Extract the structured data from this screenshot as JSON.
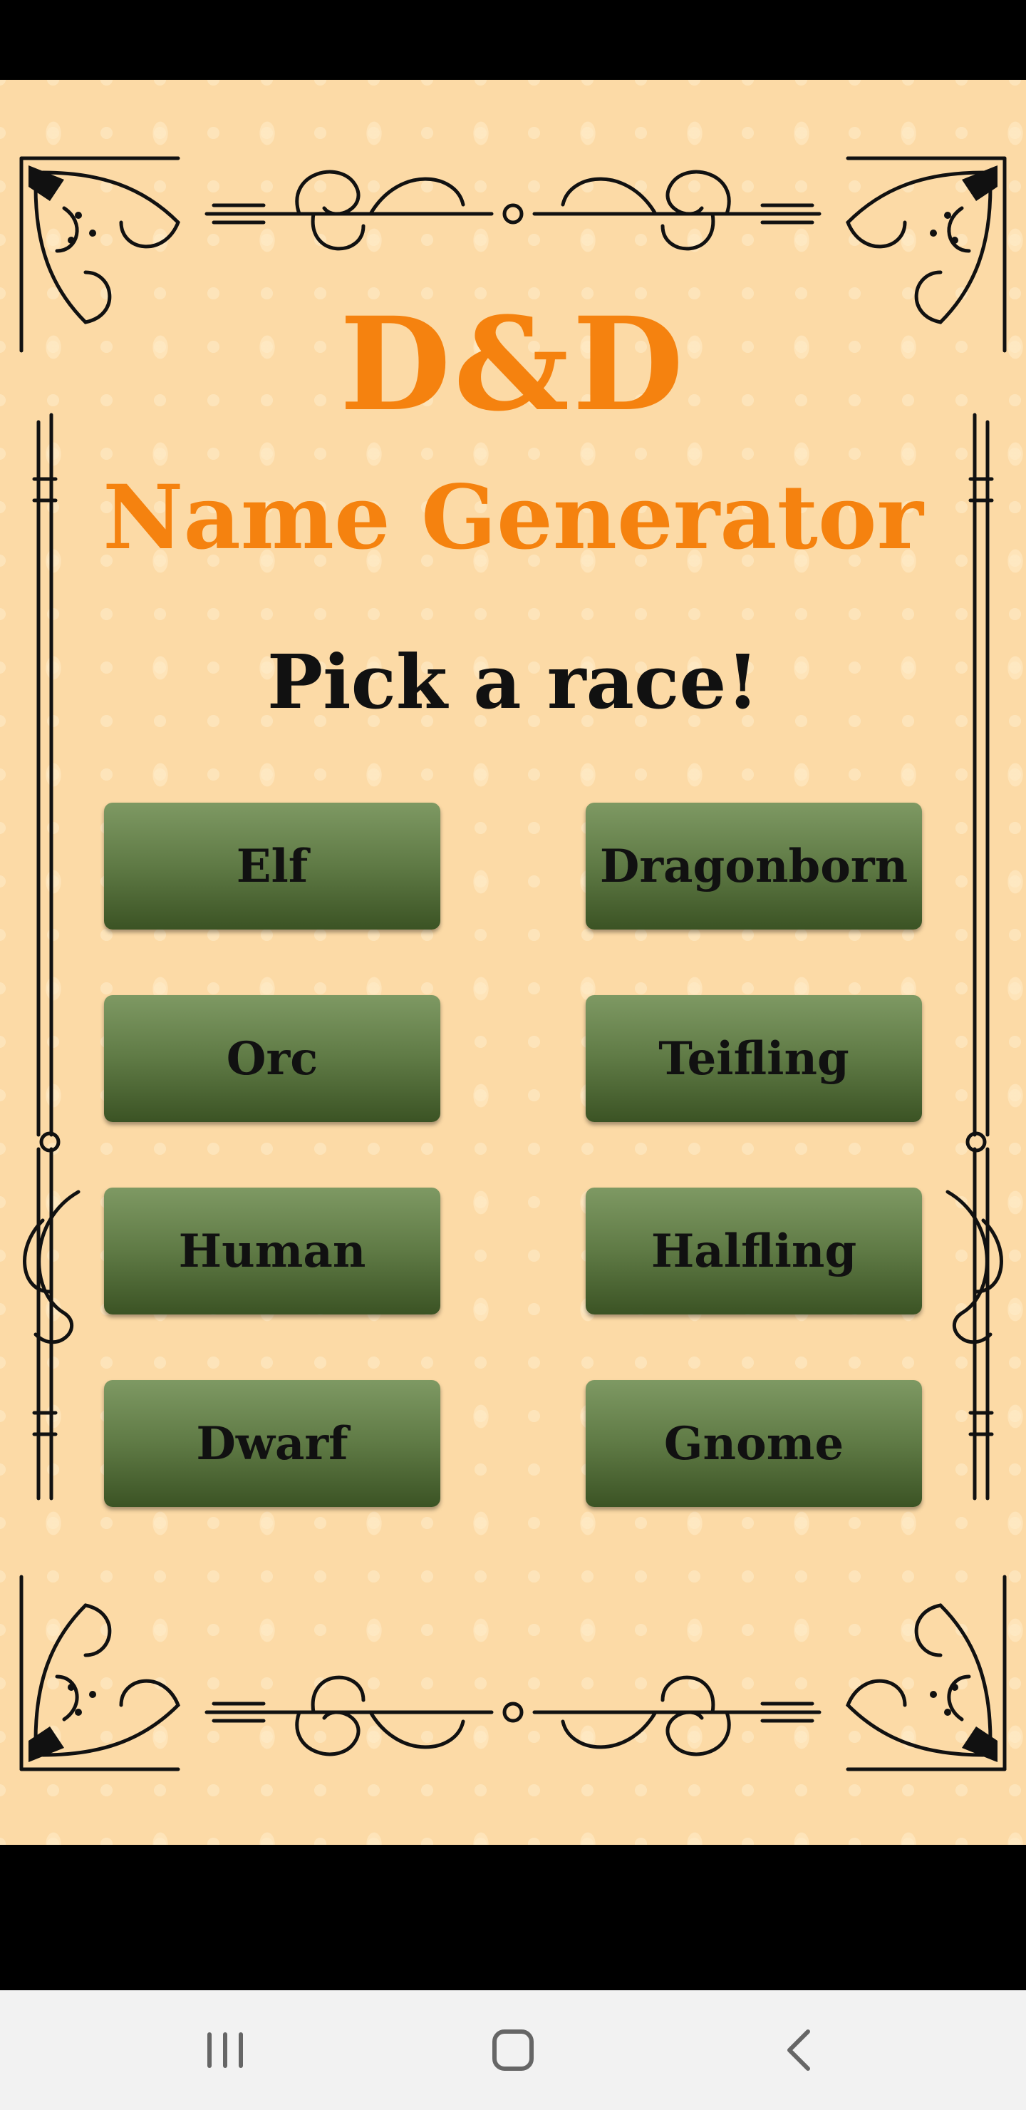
{
  "app": {
    "title": "D&D",
    "subtitle": "Name Generator",
    "prompt": "Pick a race!"
  },
  "races": [
    {
      "label": "Elf"
    },
    {
      "label": "Dragonborn"
    },
    {
      "label": "Orc"
    },
    {
      "label": "Teifling"
    },
    {
      "label": "Human"
    },
    {
      "label": "Halfling"
    },
    {
      "label": "Dwarf"
    },
    {
      "label": "Gnome"
    }
  ],
  "navigation": {
    "icons": [
      "recent-apps-icon",
      "home-icon",
      "back-icon"
    ]
  },
  "colors": {
    "parchment": "#fcdaa6",
    "title": "#f5820f",
    "button_top": "#7e9963",
    "button_bottom": "#3b5324"
  }
}
